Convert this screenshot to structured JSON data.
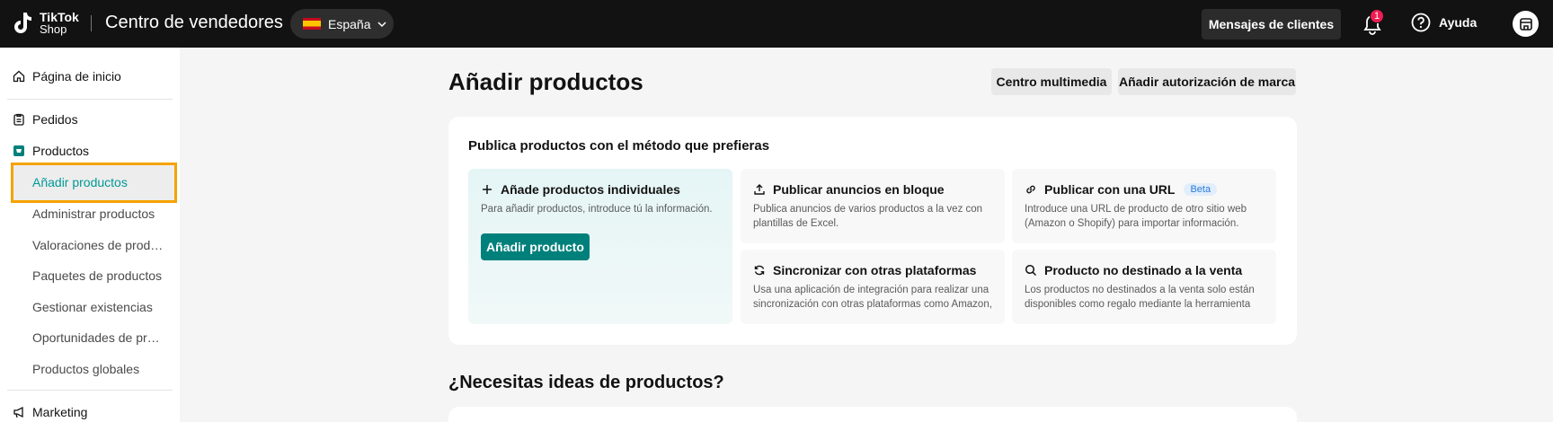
{
  "brand": {
    "line1": "TikTok",
    "line2": "Shop"
  },
  "app_title": "Centro de vendedores",
  "country": {
    "label": "España",
    "flag_icon": "spain-flag-icon"
  },
  "topbar": {
    "messages_label": "Mensajes de clientes",
    "notification_count": "1",
    "help_label": "Ayuda"
  },
  "sidebar": {
    "home": "Página de inicio",
    "orders": "Pedidos",
    "products": "Productos",
    "products_sub": [
      "Añadir productos",
      "Administrar productos",
      "Valoraciones de productos",
      "Paquetes de productos",
      "Gestionar existencias",
      "Oportunidades de productos",
      "Productos globales"
    ],
    "marketing": "Marketing"
  },
  "main": {
    "title": "Añadir productos",
    "buttons": {
      "media_center": "Centro multimedia",
      "brand_auth": "Añadir autorización de marca"
    },
    "card_title": "Publica productos con el método que prefieras",
    "options": [
      {
        "title": "Añade productos individuales",
        "desc": "Para añadir productos, introduce tú la información.",
        "button": "Añadir producto",
        "icon": "plus-icon"
      },
      {
        "title": "Publicar anuncios en bloque",
        "desc": "Publica anuncios de varios productos a la vez con plantillas de Excel.",
        "icon": "upload-icon"
      },
      {
        "title": "Publicar con una URL",
        "badge": "Beta",
        "desc": "Introduce una URL de producto de otro sitio web (Amazon o Shopify) para importar información.",
        "icon": "link-icon"
      },
      {
        "title": "Sincronizar con otras plataformas",
        "desc": "Usa una aplicación de integración para realizar una sincronización con otras plataformas como Amazon,",
        "icon": "sync-icon"
      },
      {
        "title": "Producto no destinado a la venta",
        "desc": "Los productos no destinados a la venta solo están disponibles como regalo mediante la herramienta",
        "icon": "search-icon"
      }
    ],
    "ideas_title": "¿Necesitas ideas de productos?"
  },
  "colors": {
    "accent": "#00807b",
    "active_text": "#009995",
    "highlight_border": "#f5a300",
    "badge": "#ee1d52"
  }
}
